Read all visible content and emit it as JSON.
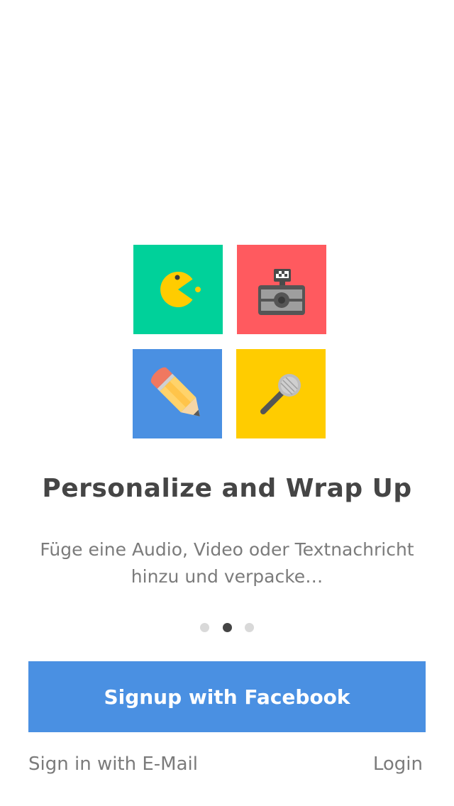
{
  "onboarding": {
    "tiles": [
      {
        "icon": "pacman-icon",
        "color": "#00d19a"
      },
      {
        "icon": "camera-icon",
        "color": "#ff5a5f"
      },
      {
        "icon": "pencil-icon",
        "color": "#4a90e2"
      },
      {
        "icon": "microphone-icon",
        "color": "#ffcc00"
      }
    ],
    "title": "Personalize and Wrap Up",
    "description": "Füge eine Audio, Video oder Textnachricht hinzu und verpacke…",
    "page_indicator": {
      "total": 3,
      "current": 2
    }
  },
  "actions": {
    "facebook_label": "Signup with Facebook",
    "facebook_color": "#4a90e2",
    "email_label": "Sign in with E-Mail",
    "login_label": "Login"
  }
}
